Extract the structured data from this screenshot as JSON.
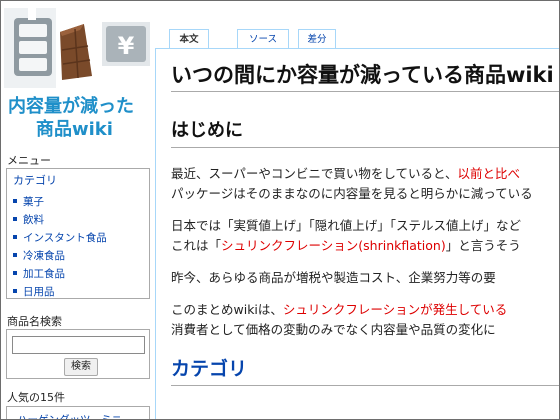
{
  "sidebar": {
    "logo": {
      "line1": "内容量が減った",
      "line2_prefix": "商品",
      "line2_wiki": "wiki",
      "currency_symbol": "¥"
    },
    "menu_heading": "メニュー",
    "menu_category": "カテゴリ",
    "menu_items": [
      {
        "label": "菓子"
      },
      {
        "label": "飲料"
      },
      {
        "label": "インスタント食品"
      },
      {
        "label": "冷凍食品"
      },
      {
        "label": "加工食品"
      },
      {
        "label": "日用品"
      }
    ],
    "search_heading": "商品名検索",
    "search_value": "",
    "search_button": "検索",
    "popular_heading": "人気の15件",
    "popular_first": "ハーゲンダッツ　ミニ"
  },
  "tabs": [
    {
      "label": "本文"
    },
    {
      "label": "ソース"
    },
    {
      "label": "差分"
    }
  ],
  "main": {
    "title": "いつの間にか容量が減っている商品wiki",
    "intro_heading": "はじめに",
    "p1_text": "最近、スーパーやコンビニで買い物をしていると、",
    "p1_red": "以前と比べ",
    "p2_text": "パッケージはそのままなのに内容量を見ると明らかに減っている",
    "p3_text": "日本では「実質値上げ」「隠れ値上げ」「ステルス値上げ」など",
    "p4_pre": "これは「",
    "p4_red": "シュリンクフレーション(shrinkflation)",
    "p4_post": "」と言うそう",
    "p5_text": "昨今、あらゆる商品が増税や製造コスト、企業努力等の要",
    "p6_pre": "このまとめwikiは、",
    "p6_red": "シュリンクフレーションが発生している",
    "p7_text": "消費者として価格の変動のみでなく内容量や品質の変化に",
    "category_heading": "カテゴリ"
  },
  "colors": {
    "link": "#0645ad",
    "accent_red": "#dd0000",
    "logo_blue": "#1f8fc9",
    "tab_border": "#a7d7f9"
  }
}
